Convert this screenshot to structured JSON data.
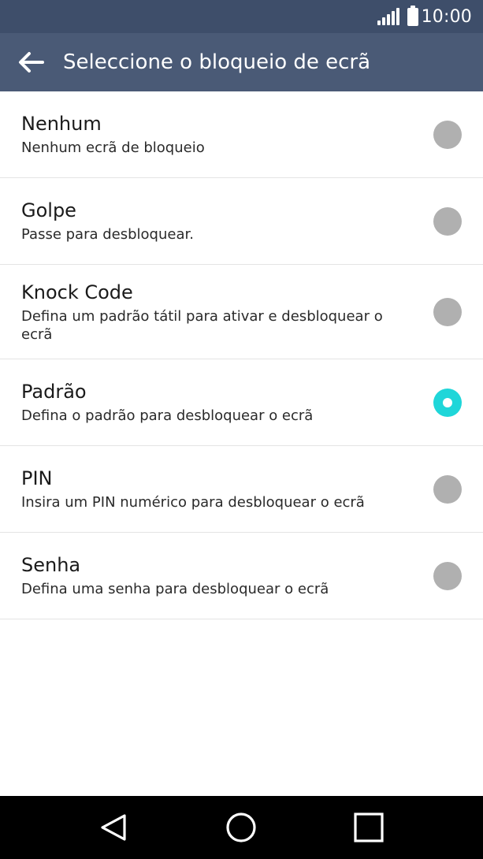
{
  "status_bar": {
    "time": "10:00"
  },
  "app_bar": {
    "title": "Seleccione o bloqueio de ecrã"
  },
  "options": [
    {
      "title": "Nenhum",
      "subtitle": "Nenhum ecrã de bloqueio",
      "selected": false
    },
    {
      "title": "Golpe",
      "subtitle": "Passe para desbloquear.",
      "selected": false
    },
    {
      "title": "Knock Code",
      "subtitle": "Defina um padrão tátil para ativar e desbloquear o ecrã",
      "selected": false
    },
    {
      "title": "Padrão",
      "subtitle": "Defina o padrão para desbloquear o ecrã",
      "selected": true
    },
    {
      "title": "PIN",
      "subtitle": "Insira um PIN numérico para desbloquear o ecrã",
      "selected": false
    },
    {
      "title": "Senha",
      "subtitle": "Defina uma senha para desbloquear o ecrã",
      "selected": false
    }
  ],
  "colors": {
    "status_bar": "#3e4e6a",
    "app_bar": "#4a5a76",
    "radio_selected": "#1fd6d9",
    "radio_unselected": "#b0b0b0"
  }
}
